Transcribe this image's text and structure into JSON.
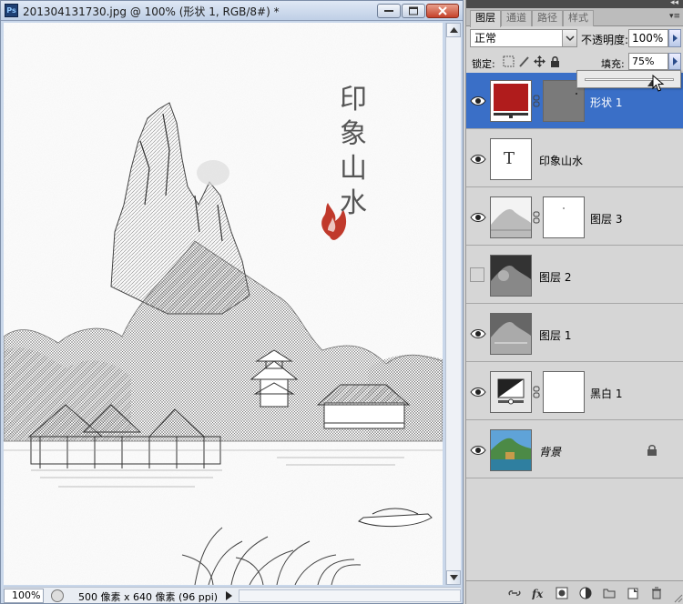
{
  "document": {
    "title": "201304131730.jpg @ 100% (形状 1, RGB/8#) *",
    "app_logo": "Ps",
    "artwork": {
      "calligraphy": [
        "印",
        "象",
        "山",
        "水"
      ]
    }
  },
  "statusbar": {
    "zoom": "100%",
    "info": "500 像素 x 640 像素 (96 ppi)"
  },
  "panel": {
    "tabs": [
      {
        "label": "图层",
        "active": true
      },
      {
        "label": "通道",
        "active": false
      },
      {
        "label": "路径",
        "active": false
      },
      {
        "label": "样式",
        "active": false
      }
    ],
    "blend_mode": "正常",
    "opacity_label": "不透明度:",
    "opacity_value": "100%",
    "lock_label": "锁定:",
    "fill_label": "填充:",
    "fill_value": "75%",
    "fill_slider_value": 0.75
  },
  "layers": [
    {
      "name": "形状 1",
      "visible": true,
      "selected": true,
      "thumb": "shape-red",
      "has_mask": true,
      "italic": false
    },
    {
      "name": "印象山水",
      "visible": true,
      "selected": false,
      "thumb": "text",
      "has_mask": false,
      "italic": false
    },
    {
      "name": "图层 3",
      "visible": true,
      "selected": false,
      "thumb": "landscape-light",
      "has_mask": true,
      "italic": false
    },
    {
      "name": "图层 2",
      "visible": false,
      "selected": false,
      "thumb": "landscape-dark",
      "has_mask": false,
      "italic": false
    },
    {
      "name": "图层 1",
      "visible": true,
      "selected": false,
      "thumb": "landscape-gray",
      "has_mask": false,
      "italic": false
    },
    {
      "name": "黑白 1",
      "visible": true,
      "selected": false,
      "thumb": "adjustment-bw",
      "has_mask": true,
      "italic": false
    },
    {
      "name": "背景",
      "visible": true,
      "selected": false,
      "thumb": "landscape-color",
      "has_mask": false,
      "italic": true,
      "locked": true
    }
  ],
  "text_thumb_glyph": "T",
  "colors": {
    "selection": "#3a6fc7",
    "seal_red": "#c0392b",
    "shape_red": "#b01c1c"
  }
}
